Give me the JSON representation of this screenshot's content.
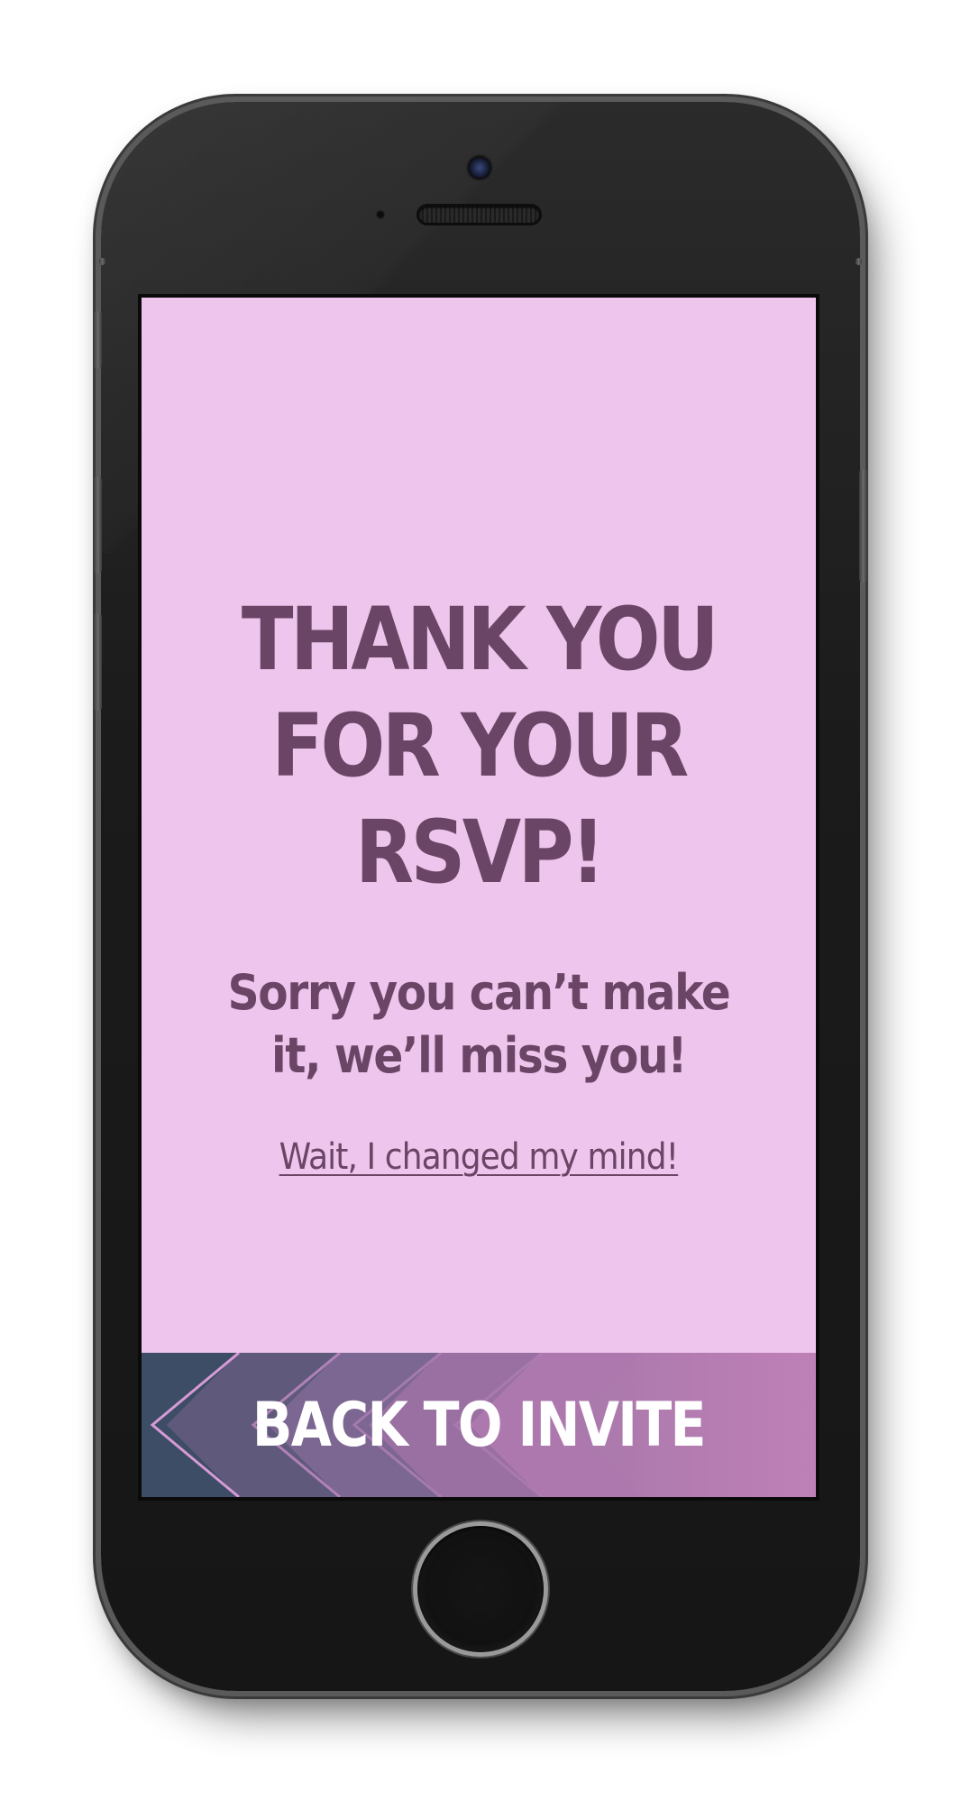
{
  "screen": {
    "headline": "THANK YOU FOR YOUR RSVP!",
    "message": "Sorry you can’t make it, we’ll miss you!",
    "change_link": "Wait, I changed my mind!",
    "back_button": "BACK TO INVITE"
  },
  "colors": {
    "screen_background": "#eec5ec",
    "text": "#6a4566",
    "button_background": "#bd7fb7",
    "button_text": "#ffffff",
    "chevron_dark": "#3e4d66",
    "chevron_line": "#d79ad6"
  },
  "icons": {
    "back_chevrons": "chevron-left-icon"
  }
}
